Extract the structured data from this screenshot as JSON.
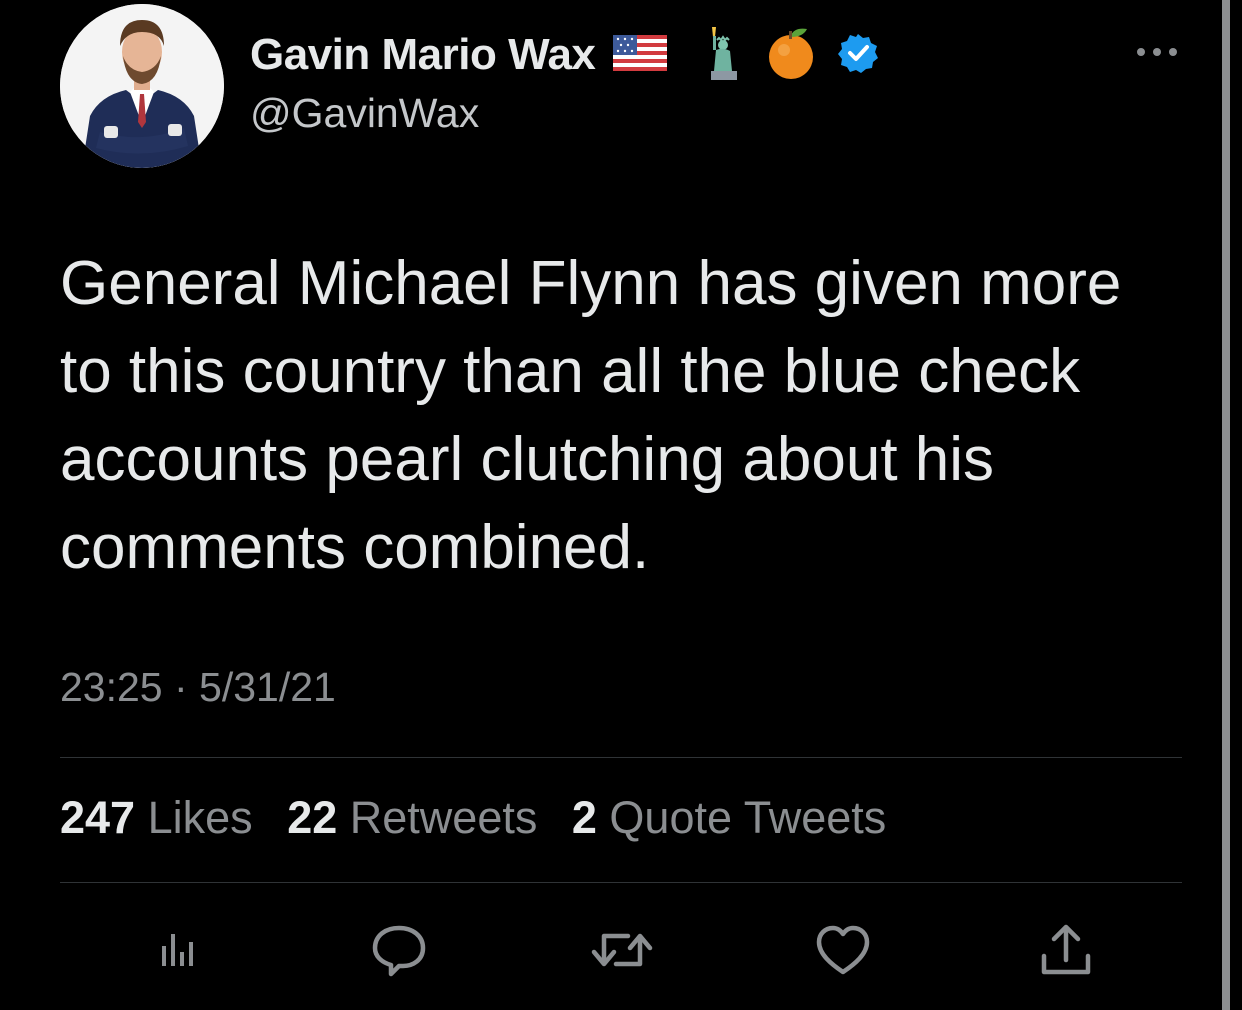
{
  "author": {
    "display_name": "Gavin Mario Wax",
    "handle": "@GavinWax",
    "name_emojis": [
      "us-flag-icon",
      "statue-of-liberty-icon",
      "orange-icon"
    ],
    "verified": true
  },
  "tweet": {
    "text": "General Michael Flynn has given more\nto this country than all the blue check\naccounts pearl clutching about his\ncomments combined.",
    "timestamp": "23:25 · 5/31/21"
  },
  "stats": {
    "likes_count": "247",
    "likes_label": "Likes",
    "retweets_count": "22",
    "retweets_label": "Retweets",
    "quotes_count": "2",
    "quotes_label": "Quote Tweets"
  },
  "actions": [
    "analytics-icon",
    "reply-icon",
    "retweet-icon",
    "like-icon",
    "share-icon"
  ],
  "colors": {
    "background": "#000000",
    "text_primary": "#e7e9ea",
    "text_secondary": "#8b8e91",
    "verified_badge": "#1d9bf0",
    "divider": "#2f3336"
  }
}
